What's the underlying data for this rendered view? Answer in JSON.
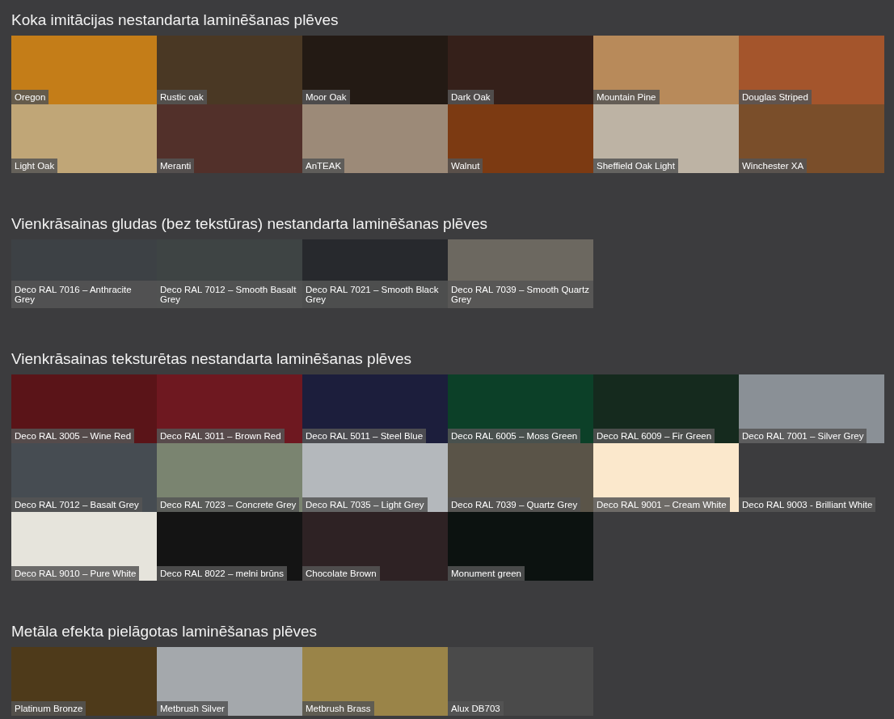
{
  "sections": [
    {
      "title": "Koka imitācijas nestandarta laminēšanas plēves",
      "kind": "tag_labels",
      "swatches": [
        {
          "label": "Oregon",
          "color": "#c47d18"
        },
        {
          "label": "Rustic oak",
          "color": "#4a3824"
        },
        {
          "label": "Moor Oak",
          "color": "#231a14"
        },
        {
          "label": "Dark Oak",
          "color": "#35201a"
        },
        {
          "label": "Mountain Pine",
          "color": "#b88a5a"
        },
        {
          "label": "Douglas Striped",
          "color": "#a4552c"
        },
        {
          "label": "Light Oak",
          "color": "#c0a677"
        },
        {
          "label": "Meranti",
          "color": "#52302a"
        },
        {
          "label": "AnTEAK",
          "color": "#9c8a78"
        },
        {
          "label": "Walnut",
          "color": "#7c3a12"
        },
        {
          "label": "Sheffield Oak Light",
          "color": "#bdb3a4"
        },
        {
          "label": "Winchester XA",
          "color": "#7a4e2a"
        }
      ]
    },
    {
      "title": "Vienkrāsainas gludas (bez tekstūras) nestandarta laminēšanas plēves",
      "kind": "wide_labels",
      "swatches": [
        {
          "label": "Deco RAL 7016 – Anthracite Grey",
          "color": "#3d4145"
        },
        {
          "label": "Deco RAL 7012 – Smooth Basalt Grey",
          "color": "#3e4444"
        },
        {
          "label": "Deco RAL 7021 – Smooth Black Grey",
          "color": "#27292d"
        },
        {
          "label": "Deco RAL 7039 – Smooth Quartz Grey",
          "color": "#6c6860"
        }
      ]
    },
    {
      "title": "Vienkrāsainas teksturētas nestandarta laminēšanas plēves",
      "kind": "tag_labels",
      "swatches": [
        {
          "label": "Deco RAL 3005 – Wine Red",
          "color": "#5a1418"
        },
        {
          "label": "Deco RAL 3011 – Brown Red",
          "color": "#6e1820"
        },
        {
          "label": "Deco RAL 5011 – Steel Blue",
          "color": "#1c1e3c"
        },
        {
          "label": "Deco RAL 6005 – Moss Green",
          "color": "#0c4028"
        },
        {
          "label": "Deco RAL 6009 – Fir Green",
          "color": "#152a1e"
        },
        {
          "label": "Deco RAL 7001 – Silver Grey",
          "color": "#8a9096"
        },
        {
          "label": "Deco RAL 7012 – Basalt Grey",
          "color": "#464c52"
        },
        {
          "label": "Deco RAL 7023 – Concrete Grey",
          "color": "#7a8470"
        },
        {
          "label": "Deco RAL 7035 – Light Grey",
          "color": "#b4b8bc"
        },
        {
          "label": "Deco RAL 7039 – Quartz Grey",
          "color": "#5a5448"
        },
        {
          "label": "Deco RAL 9001 – Cream White",
          "color": "#fbe8cc"
        },
        {
          "label": "Deco RAL 9003 - Brilliant White",
          "color": "#3c3c3e"
        },
        {
          "label": "Deco RAL 9010 – Pure White",
          "color": "#e6e4dc"
        },
        {
          "label": "Deco RAL 8022 – melni brūns",
          "color": "#141414"
        },
        {
          "label": "Chocolate Brown",
          "color": "#2e2224"
        },
        {
          "label": "Monument green",
          "color": "#0c1210"
        }
      ]
    },
    {
      "title": "Metāla efekta pielāgotas laminēšanas plēves",
      "kind": "tag_labels",
      "swatches": [
        {
          "label": "Platinum Bronze",
          "color": "#4e3a1a"
        },
        {
          "label": "Metbrush Silver",
          "color": "#a4a8ac"
        },
        {
          "label": "Metbrush Brass",
          "color": "#9a8448"
        },
        {
          "label": "Alux DB703",
          "color": "#4a4a4a"
        }
      ]
    }
  ]
}
